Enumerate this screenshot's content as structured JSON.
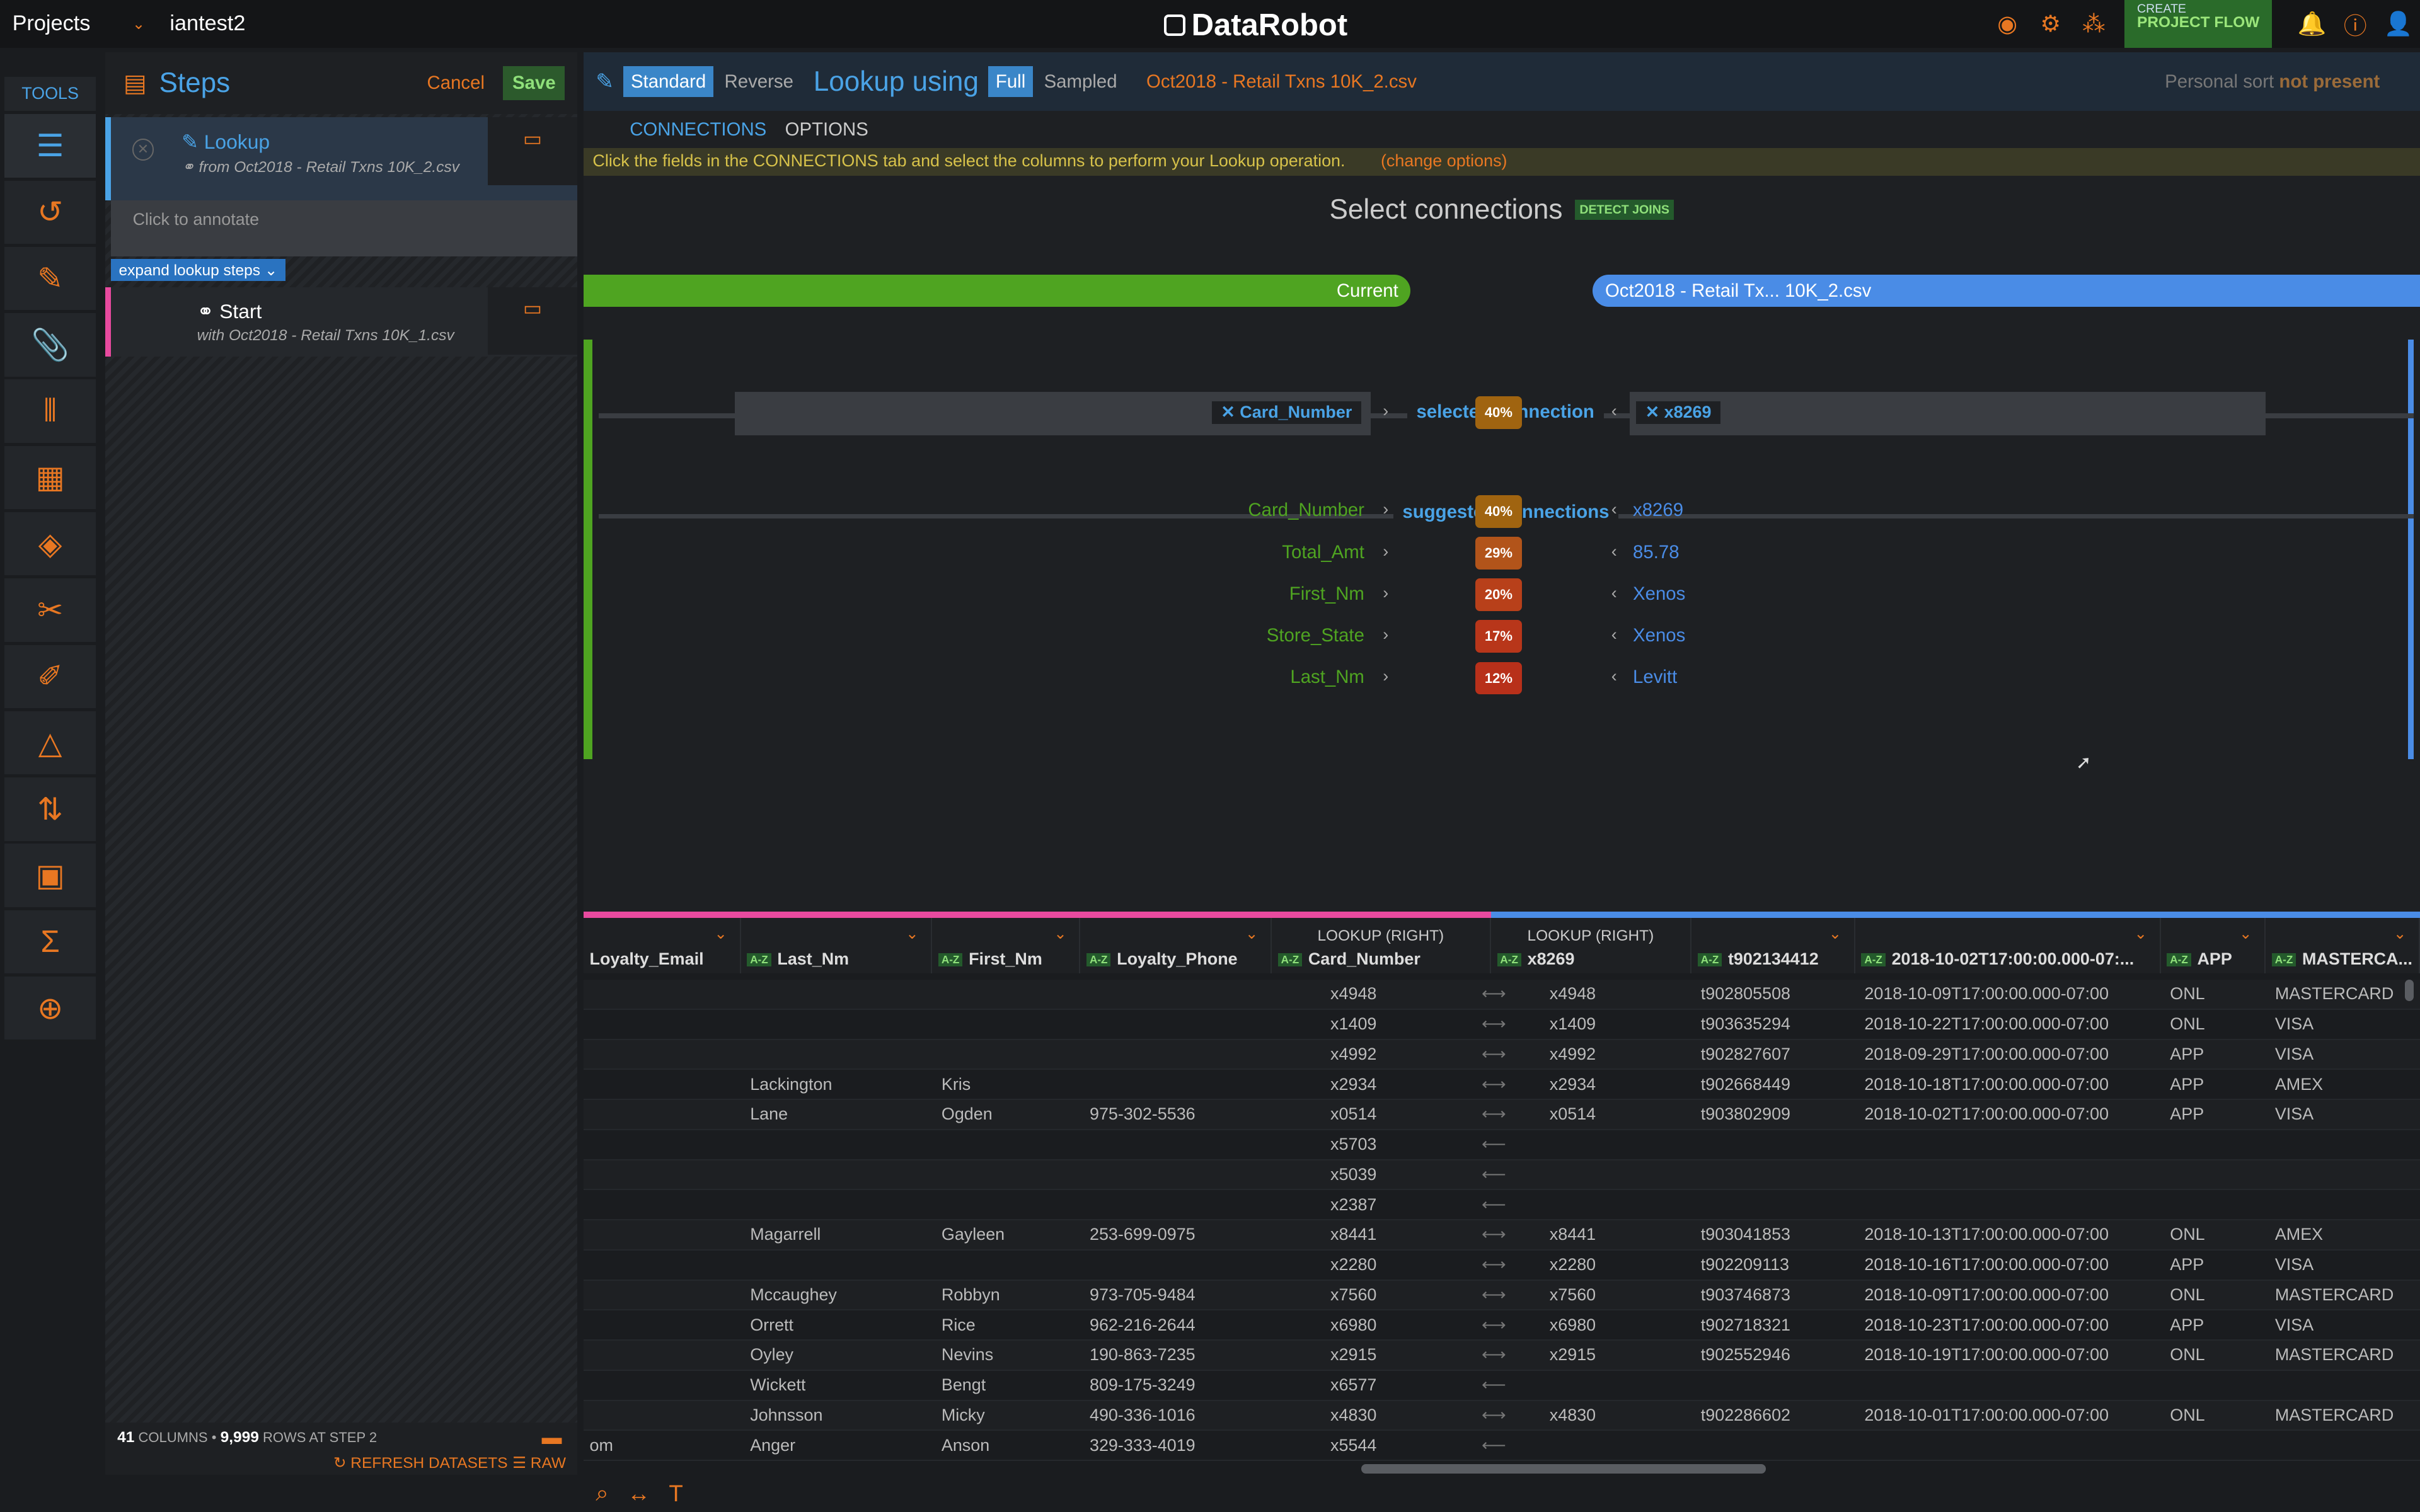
{
  "header": {
    "projects_label": "Projects",
    "project_name": "iantest2",
    "logo": "DataRobot",
    "create_small": "CREATE",
    "create_big": "PROJECT FLOW"
  },
  "tools": {
    "label": "TOOLS",
    "items": [
      "steps-icon",
      "history-icon",
      "pencil-icon",
      "paperclip-icon",
      "columns-icon",
      "calculator-icon",
      "git-icon",
      "scissors-icon",
      "edit-icon",
      "shapes-icon",
      "sort-icon",
      "robot-icon",
      "sql-icon",
      "add-icon"
    ]
  },
  "steps": {
    "title": "Steps",
    "cancel": "Cancel",
    "save": "Save",
    "lookup_name": "Lookup",
    "lookup_from_prefix": "from",
    "lookup_from_file": "Oct2018 - Retail Txns 10K_2.csv",
    "annotate": "Click to annotate",
    "expand": "expand lookup steps",
    "start_name": "Start",
    "start_with_prefix": "with",
    "start_with_file": "Oct2018 - Retail Txns 10K_1.csv",
    "footer_cols": "41",
    "footer_cols_label": "COLUMNS •",
    "footer_rows": "9,999",
    "footer_rows_label": "ROWS AT STEP 2",
    "refresh": "REFRESH DATASETS",
    "raw": "RAW"
  },
  "lookup": {
    "mode_standard": "Standard",
    "mode_reverse": "Reverse",
    "using": "Lookup using",
    "full": "Full",
    "sampled": "Sampled",
    "file": "Oct2018 - Retail Txns 10K_2.csv",
    "sort_prefix": "Personal sort",
    "sort_status": "not present",
    "tab_connections": "CONNECTIONS",
    "tab_options": "OPTIONS",
    "info": "Click the fields in the CONNECTIONS tab and select the columns to perform your Lookup operation.",
    "change_options": "(change options)",
    "select_title": "Select connections",
    "detect_joins": "DETECT JOINS",
    "current": "Current",
    "right_name": "Oct2018 - Retail Tx... 10K_2.csv",
    "selected_label": "selected connection",
    "selected_left": "Card_Number",
    "selected_right": "x8269",
    "selected_pct": "40%",
    "suggested_label": "suggested connections",
    "suggested": [
      {
        "left": "Card_Number",
        "pct": "40%",
        "right": "x8269",
        "color": "#a06410"
      },
      {
        "left": "Total_Amt",
        "pct": "29%",
        "right": "85.78",
        "color": "#b2541a"
      },
      {
        "left": "First_Nm",
        "pct": "20%",
        "right": "Xenos",
        "color": "#b8401a"
      },
      {
        "left": "Store_State",
        "pct": "17%",
        "right": "Xenos",
        "color": "#b8361a"
      },
      {
        "left": "Last_Nm",
        "pct": "12%",
        "right": "Levitt",
        "color": "#b8301a"
      }
    ]
  },
  "table": {
    "lookup_label": "LOOKUP (RIGHT)",
    "columns": [
      "Loyalty_Email",
      "Last_Nm",
      "First_Nm",
      "Loyalty_Phone",
      "Card_Number",
      "x8269",
      "t902134412",
      "2018-10-02T17:00:00.000-07:...",
      "APP",
      "MASTERCA..."
    ],
    "rows": [
      [
        "",
        "",
        "",
        "",
        "x4948",
        "x4948",
        "t902805508",
        "2018-10-09T17:00:00.000-07:00",
        "ONL",
        "MASTERCARD"
      ],
      [
        "",
        "",
        "",
        "",
        "x1409",
        "x1409",
        "t903635294",
        "2018-10-22T17:00:00.000-07:00",
        "ONL",
        "VISA"
      ],
      [
        "",
        "",
        "",
        "",
        "x4992",
        "x4992",
        "t902827607",
        "2018-09-29T17:00:00.000-07:00",
        "APP",
        "VISA"
      ],
      [
        "",
        "Lackington",
        "Kris",
        "",
        "x2934",
        "x2934",
        "t902668449",
        "2018-10-18T17:00:00.000-07:00",
        "APP",
        "AMEX"
      ],
      [
        "",
        "Lane",
        "Ogden",
        "975-302-5536",
        "x0514",
        "x0514",
        "t903802909",
        "2018-10-02T17:00:00.000-07:00",
        "APP",
        "VISA"
      ],
      [
        "",
        "",
        "",
        "",
        "x5703",
        "",
        "",
        "",
        "",
        ""
      ],
      [
        "",
        "",
        "",
        "",
        "x5039",
        "",
        "",
        "",
        "",
        ""
      ],
      [
        "",
        "",
        "",
        "",
        "x2387",
        "",
        "",
        "",
        "",
        ""
      ],
      [
        "",
        "Magarrell",
        "Gayleen",
        "253-699-0975",
        "x8441",
        "x8441",
        "t903041853",
        "2018-10-13T17:00:00.000-07:00",
        "ONL",
        "AMEX"
      ],
      [
        "",
        "",
        "",
        "",
        "x2280",
        "x2280",
        "t902209113",
        "2018-10-16T17:00:00.000-07:00",
        "APP",
        "VISA"
      ],
      [
        "",
        "Mccaughey",
        "Robbyn",
        "973-705-9484",
        "x7560",
        "x7560",
        "t903746873",
        "2018-10-09T17:00:00.000-07:00",
        "ONL",
        "MASTERCARD"
      ],
      [
        "",
        "Orrett",
        "Rice",
        "962-216-2644",
        "x6980",
        "x6980",
        "t902718321",
        "2018-10-23T17:00:00.000-07:00",
        "APP",
        "VISA"
      ],
      [
        "",
        "Oyley",
        "Nevins",
        "190-863-7235",
        "x2915",
        "x2915",
        "t902552946",
        "2018-10-19T17:00:00.000-07:00",
        "ONL",
        "MASTERCARD"
      ],
      [
        "",
        "Wickett",
        "Bengt",
        "809-175-3249",
        "x6577",
        "",
        "",
        "",
        "",
        ""
      ],
      [
        "",
        "Johnsson",
        "Micky",
        "490-336-1016",
        "x4830",
        "x4830",
        "t902286602",
        "2018-10-01T17:00:00.000-07:00",
        "ONL",
        "MASTERCARD"
      ],
      [
        "om",
        "Anger",
        "Anson",
        "329-333-4019",
        "x5544",
        "",
        "",
        "",
        "",
        ""
      ]
    ]
  },
  "colors": {
    "accent_blue": "#4aa3e6",
    "accent_orange": "#e87722",
    "green": "#4fa421"
  }
}
